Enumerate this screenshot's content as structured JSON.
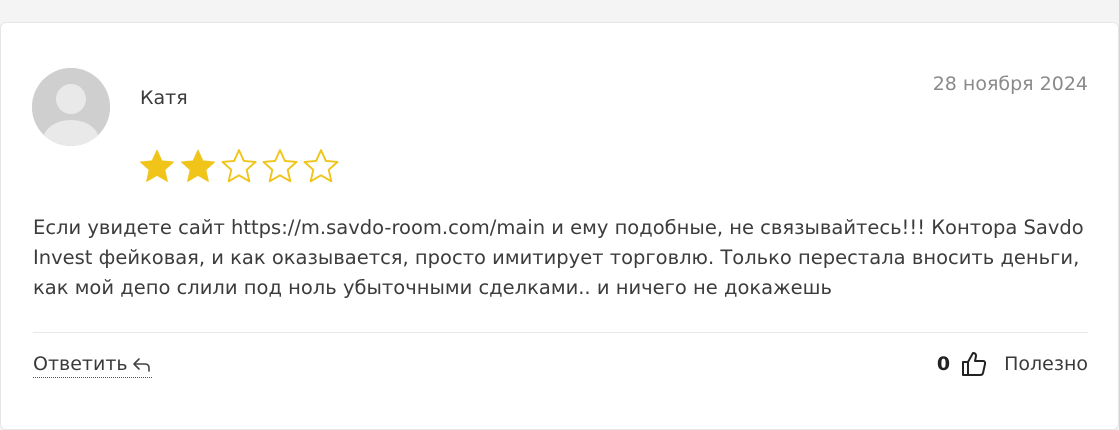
{
  "review": {
    "author": "Катя",
    "date": "28 ноября 2024",
    "rating": 2,
    "max_rating": 5,
    "text": "Если увидете сайт https://m.savdo-room.com/main и ему подобные, не связывайтесь!!! Контора Savdo Invest фейковая, и как оказывается, просто имитирует торговлю. Только перестала вносить деньги, как мой депо слили под ноль убыточными сделками.. и ничего не докажешь"
  },
  "actions": {
    "reply_label": "Ответить",
    "helpful_count": "0",
    "helpful_label": "Полезно"
  },
  "icons": {
    "avatar": "user-avatar-placeholder",
    "star_filled": "star-filled-icon",
    "star_empty": "star-empty-icon",
    "reply": "reply-arrow-icon",
    "like": "thumbs-up-icon"
  },
  "colors": {
    "star": "#f0c419",
    "avatar_bg": "#cfcfcf",
    "date": "#8a8a8a"
  }
}
